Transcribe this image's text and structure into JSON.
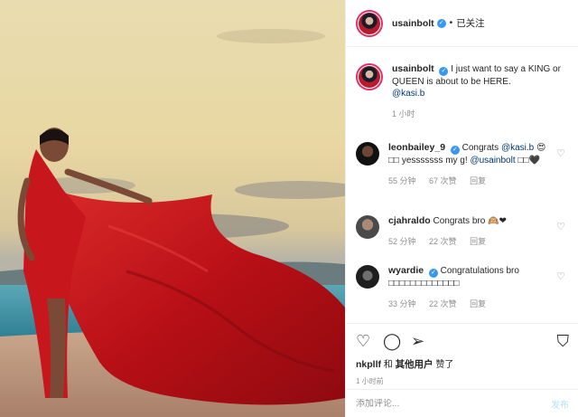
{
  "post": {
    "author": "usainbolt",
    "verified_mark": "✓",
    "follow_status": "已关注",
    "caption_text": "I just want to say a KING or QUEEN is about to be HERE.",
    "caption_mention": "@kasi.b",
    "caption_time": "1 小时"
  },
  "comments": [
    {
      "user": "leonbailey_9",
      "verified": true,
      "text_prefix": "Congrats ",
      "mention": "@kasi.b",
      "text_suffix": " 😍□□ yesssssss my g! ",
      "mention2": "@usainbolt",
      "text_end": " □□🖤",
      "time": "55 分钟",
      "likes": "67 次赞",
      "reply": "回复"
    },
    {
      "user": "cjahraldo",
      "verified": false,
      "text": "Congrats bro 🙉❤",
      "time": "52 分钟",
      "likes": "22 次赞",
      "reply": "回复"
    },
    {
      "user": "wyardie",
      "verified": true,
      "text": "Congratulations bro □□□□□□□□□□□□□",
      "time": "33 分钟",
      "likes": "22 次赞",
      "reply": "回复"
    }
  ],
  "actions": {
    "like_icon": "heart-outline-icon",
    "comment_icon": "comment-bubble-icon",
    "share_icon": "paper-plane-icon",
    "save_icon": "bookmark-icon",
    "liked_by_user": "nkpllf",
    "liked_by_and": " 和 ",
    "liked_by_others": "其他用户",
    "liked_by_end": " 赞了",
    "post_age": "1 小时前"
  },
  "add_comment": {
    "placeholder": "添加评论...",
    "post_label": "发布"
  },
  "colors": {
    "accent": "#3897f0",
    "link": "#00376b",
    "muted": "#8e8e8e",
    "dress_red": "#c8161d"
  }
}
